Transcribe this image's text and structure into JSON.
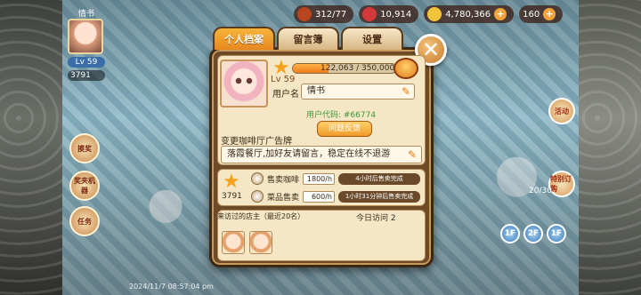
{
  "topbar": {
    "res1": "312/77",
    "res2": "10,914",
    "res3": "4,780,366",
    "res4": "160"
  },
  "player": {
    "name": "情书",
    "level": "Lv 59",
    "coins": "3791"
  },
  "tabs": [
    {
      "label": "个人档案"
    },
    {
      "label": "留言簿"
    },
    {
      "label": "设置"
    }
  ],
  "profile": {
    "level": "Lv 59",
    "xp_text": "122,063 / 350,000",
    "xp_fraction": 0.349,
    "username_label": "用户名",
    "username": "情书",
    "user_code": "用户代码: #66774",
    "feedback_label": "问题反馈",
    "ad_title": "变更咖啡厅广告牌",
    "ad_text": "落霞餐厅,加好友请留言，稳定在线不退游"
  },
  "stats": {
    "rank_value": "3791",
    "coffee_label": "售卖咖啡",
    "coffee_value": "1800/h",
    "coffee_note": "4小时后售卖完成",
    "dish_label": "菜品售卖",
    "dish_value": "600/h",
    "dish_note": "1小时31分钟后售卖完成"
  },
  "visitors": {
    "title": "来访过的店主（最近20名）",
    "today": "今日访问 2"
  },
  "side": {
    "left1": "摸奖",
    "left2": "奖夹机器",
    "left3": "任务",
    "right1": "活动",
    "right2": "特别订购",
    "floor1": "1F",
    "floor2": "2F",
    "floor3": "1F",
    "counter": "20/30",
    "timestamp": "2024/11/7 08:57:04 pm"
  }
}
